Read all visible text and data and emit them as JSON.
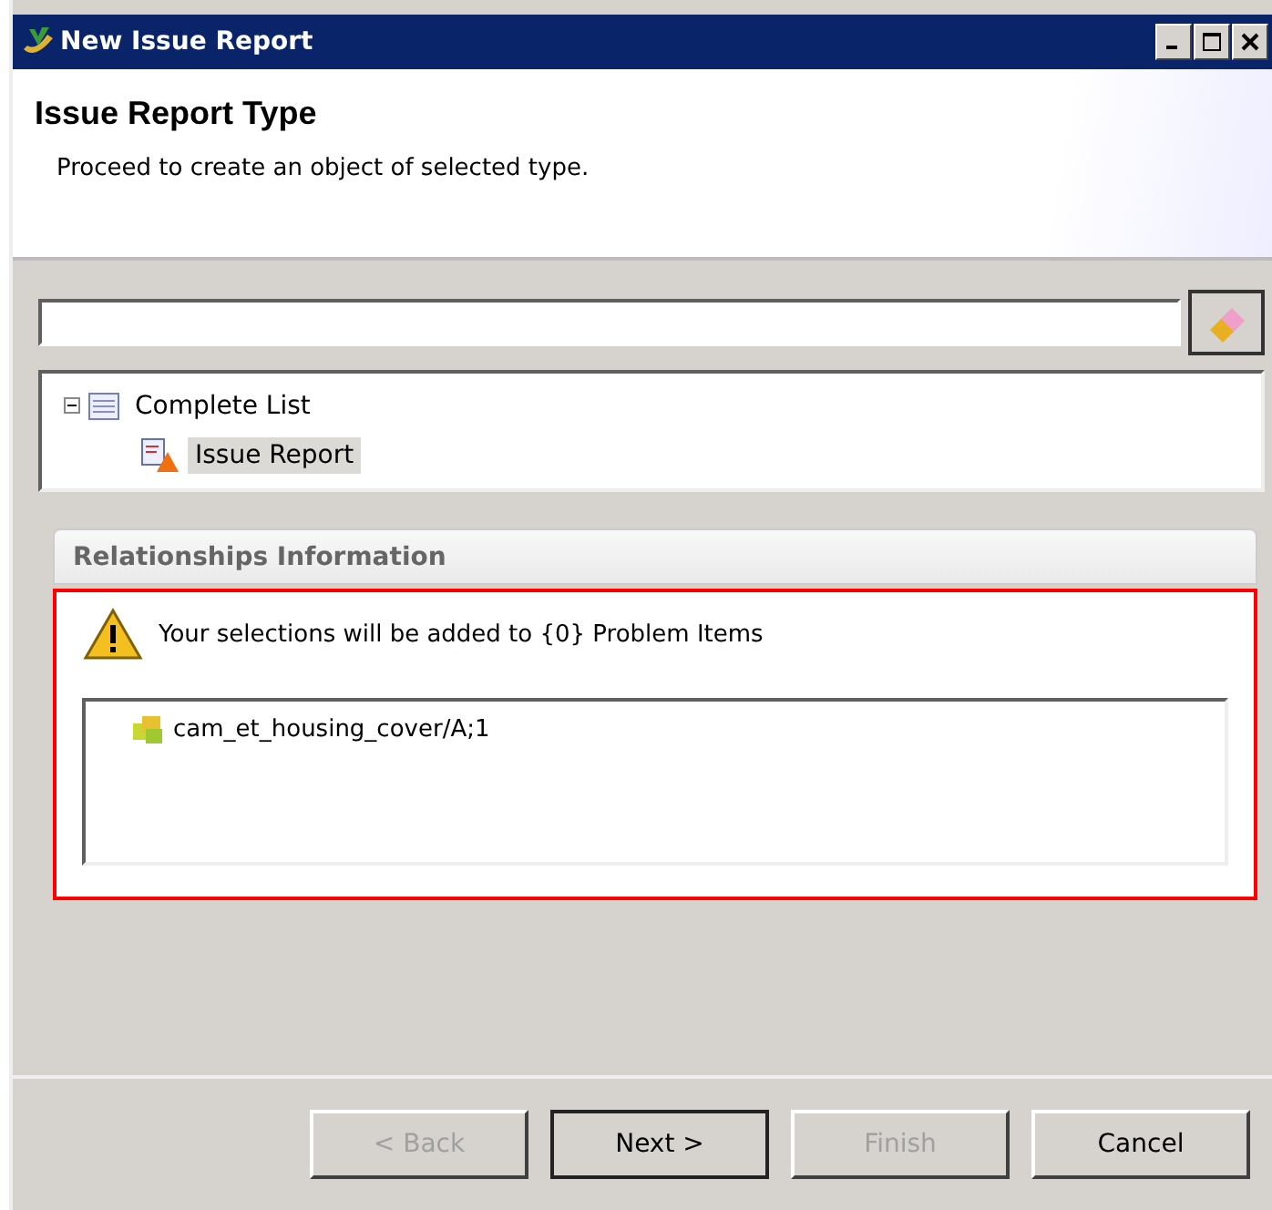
{
  "window": {
    "title": "New Issue Report"
  },
  "header": {
    "title": "Issue Report Type",
    "description": "Proceed to create an object of selected type."
  },
  "tree": [
    {
      "label": "Complete List",
      "expanded": true,
      "selected": false,
      "children": [
        {
          "label": "Issue Report",
          "selected": true
        }
      ]
    }
  ],
  "relationships": {
    "title": "Relationships Information",
    "message": "Your selections will be added to {0}  Problem Items",
    "items": [
      {
        "label": "cam_et_housing_cover/A;1"
      }
    ]
  },
  "buttons": [
    {
      "label": "< Back",
      "disabled": true,
      "default": false
    },
    {
      "label": "Next >",
      "disabled": false,
      "default": true
    },
    {
      "label": "Finish",
      "disabled": true,
      "default": false
    },
    {
      "label": "Cancel",
      "disabled": false,
      "default": false
    }
  ]
}
